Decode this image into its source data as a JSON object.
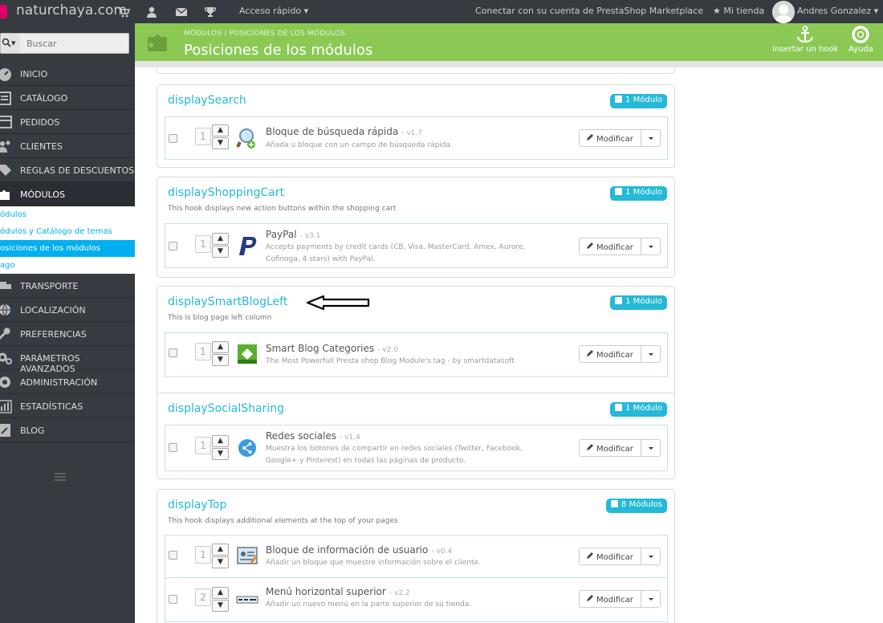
{
  "topbar": {
    "shop_name": "naturchaya.com",
    "quick_access": "Acceso rápido ▾",
    "connect": "Conectar con su cuenta de PrestaShop Marketplace",
    "my_store": "★ Mi tienda",
    "user": "Andres Gonzalez ▾"
  },
  "sidebar": {
    "search_placeholder": "Buscar",
    "items": [
      {
        "label": "INICIO"
      },
      {
        "label": "CATÁLOGO"
      },
      {
        "label": "PEDIDOS"
      },
      {
        "label": "CLIENTES"
      },
      {
        "label": "REGLAS DE DESCUENTOS"
      },
      {
        "label": "MÓDULOS"
      },
      {
        "label": "TRANSPORTE"
      },
      {
        "label": "LOCALIZACIÓN"
      },
      {
        "label": "PREFERENCIAS"
      },
      {
        "label": "PARÁMETROS AVANZADOS"
      },
      {
        "label": "ADMINISTRACIÓN"
      },
      {
        "label": "ESTADÍSTICAS"
      },
      {
        "label": "BLOG"
      }
    ],
    "submenu": [
      {
        "label": "ódulos"
      },
      {
        "label": "ódulos y Catálogo de temas"
      },
      {
        "label": "osiciones de los módulos"
      },
      {
        "label": "ago"
      }
    ]
  },
  "header": {
    "breadcrumb": "MÓDULOS  /  POSICIONES DE LOS MÓDULOS",
    "title": "Posiciones de los módulos",
    "transplant": "Insertar un hook",
    "help": "Ayuda"
  },
  "modify_label": "Modificar",
  "hooks": [
    {
      "name": "displaySearch",
      "description": "",
      "badge": "1 Módulo",
      "modules": [
        {
          "position": "1",
          "name": "Bloque de búsqueda rápida",
          "version": "- v1.7",
          "description": "Añada u bloque con un campo de búsqueda rápida",
          "icon": "magnifier-icon"
        }
      ]
    },
    {
      "name": "displayShoppingCart",
      "description": "This hook displays new action buttons within the shopping cart",
      "badge": "1 Módulo",
      "modules": [
        {
          "position": "1",
          "name": "PayPal",
          "version": "- v3.1",
          "description": "Accepts payments by credit cards (CB, Visa, MasterCard, Amex, Aurore, Cofinoga, 4 stars) with PayPal.",
          "icon": "paypal-icon"
        }
      ]
    },
    {
      "name": "displaySmartBlogLeft",
      "description": "This is blog page left column",
      "badge": "1 Módulo",
      "modules": [
        {
          "position": "1",
          "name": "Smart Blog Categories",
          "version": "- v2.0",
          "description": "The Most Powerfull Presta shop Blog Module's tag - by smartdatasoft",
          "icon": "smartblog-icon"
        }
      ]
    },
    {
      "name": "displaySocialSharing",
      "description": "",
      "badge": "1 Módulo",
      "modules": [
        {
          "position": "1",
          "name": "Redes sociales",
          "version": "- v1.4",
          "description": "Muestra los botones de compartir en redes sociales (Twitter, Facebook, Google+ y Pinterest) en todas las páginas de producto.",
          "icon": "share-icon"
        }
      ]
    },
    {
      "name": "displayTop",
      "description": "This hook displays additional elements at the top of your pages",
      "badge": "8 Módulos",
      "modules": [
        {
          "position": "1",
          "name": "Bloque de información de usuario",
          "version": "- v0.4",
          "description": "Añadir un bloque que muestre información sobre el cliente.",
          "icon": "user-info-icon"
        },
        {
          "position": "2",
          "name": "Menú horizontal superior",
          "version": "- v2.2",
          "description": "Añadir un nuevo menú en la parte superior de su tienda.",
          "icon": "horizontal-menu-icon"
        }
      ]
    }
  ]
}
